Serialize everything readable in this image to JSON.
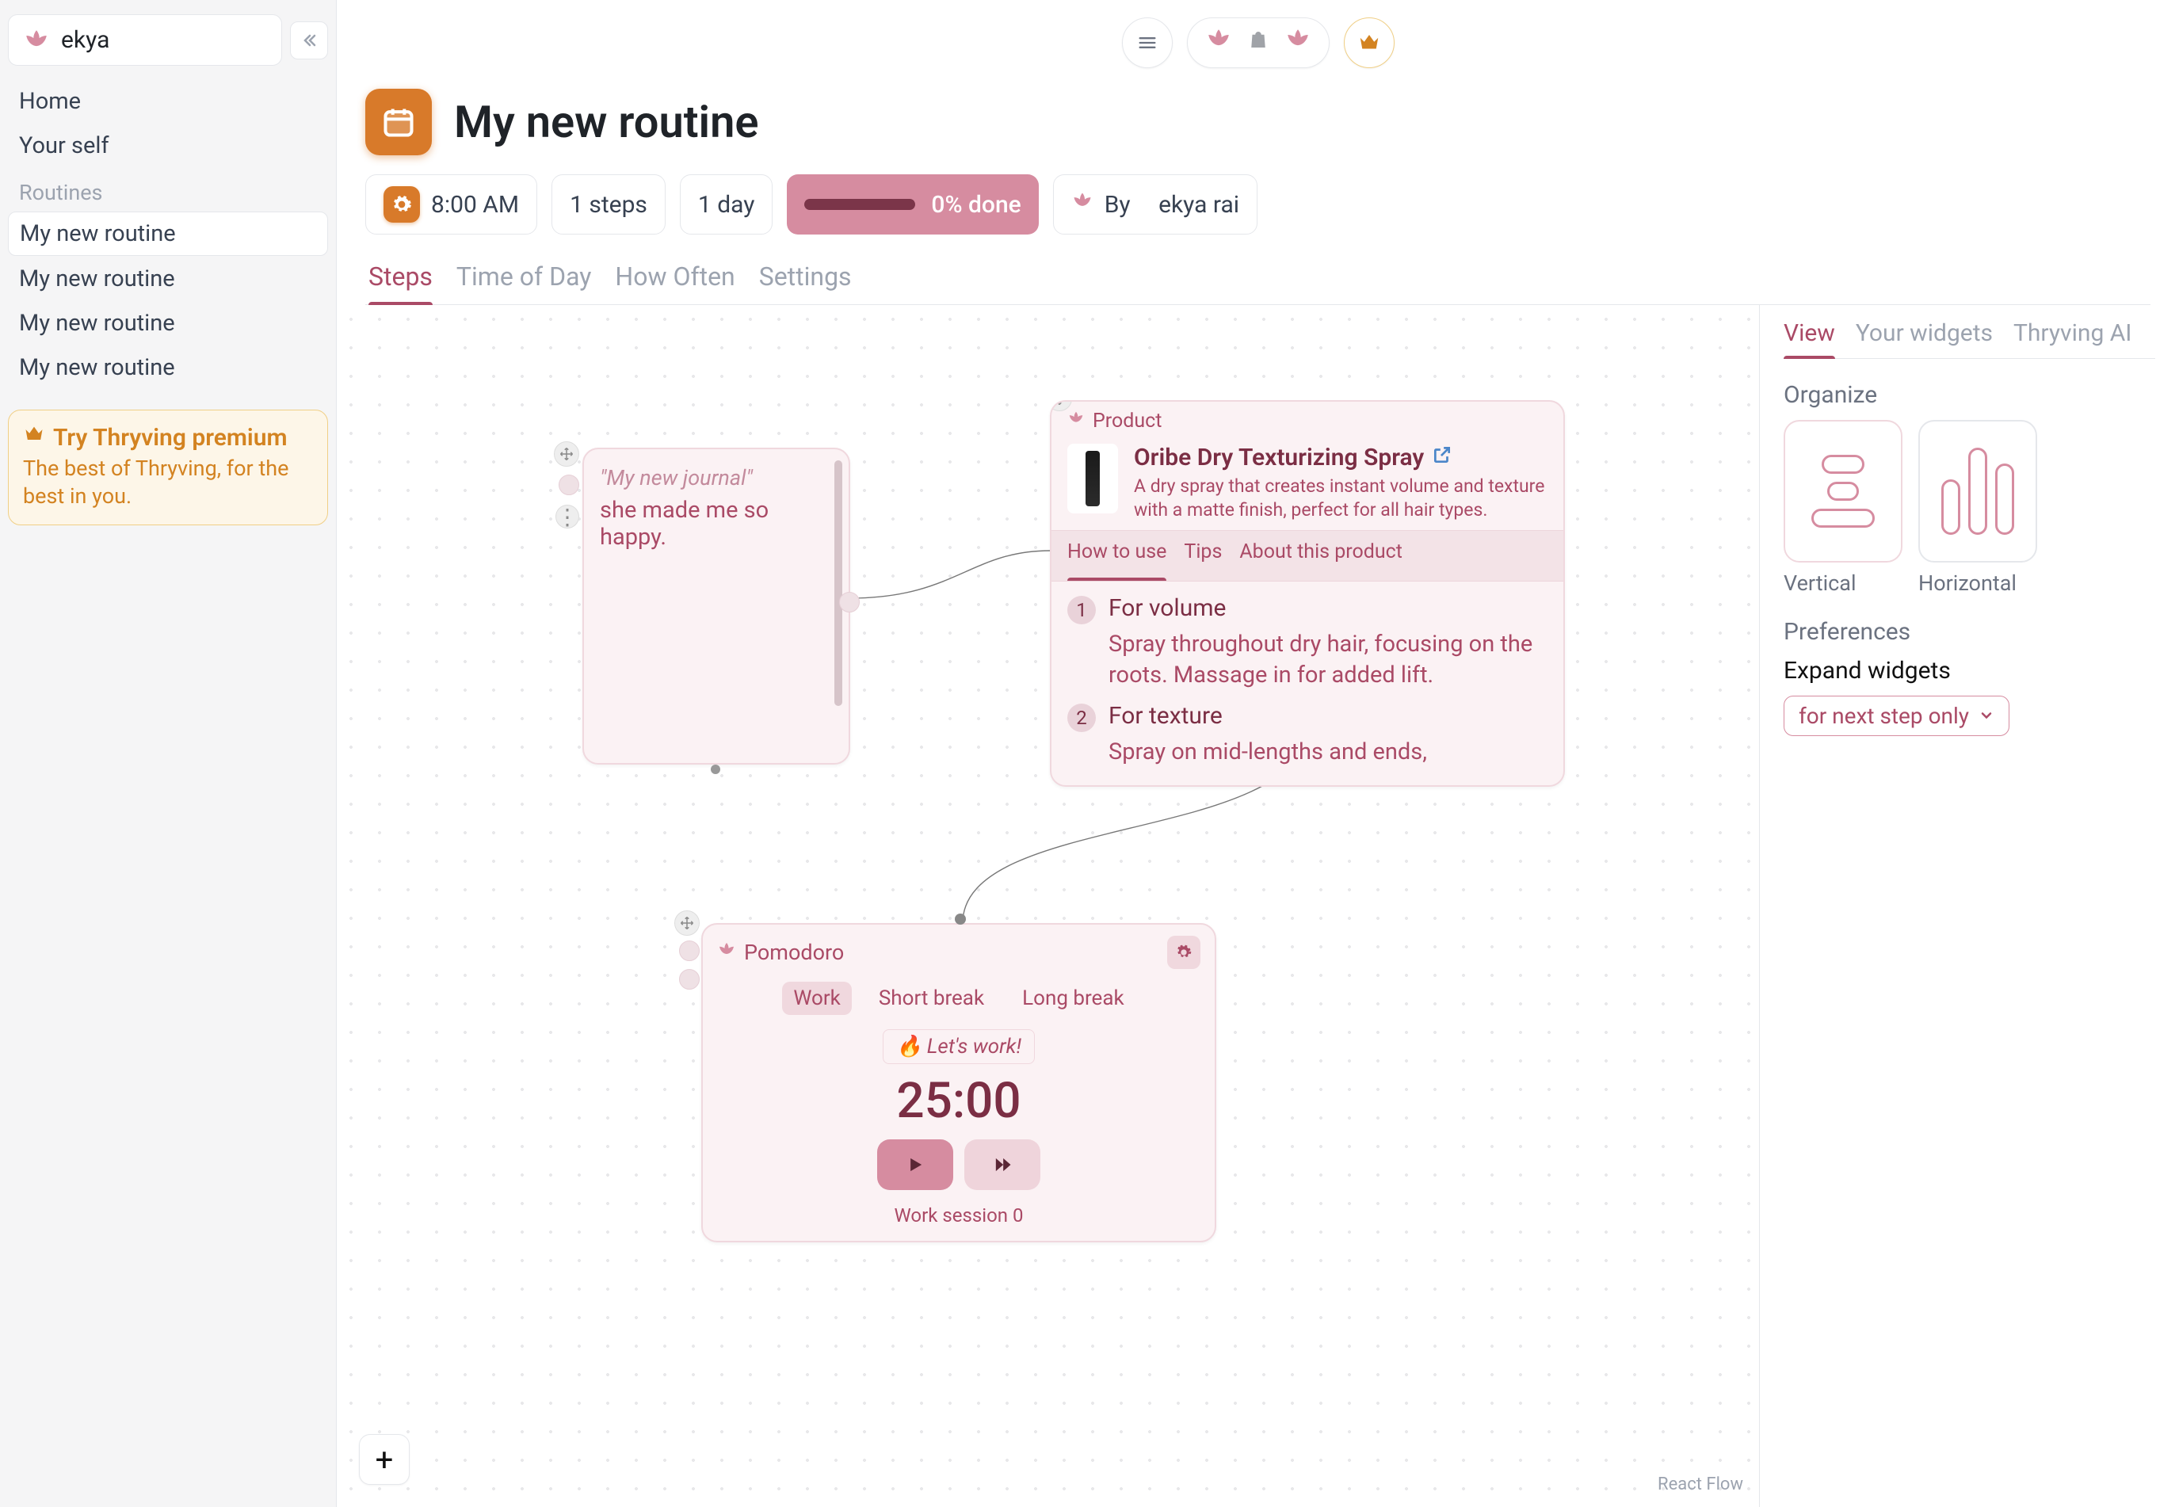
{
  "workspace": {
    "name": "ekya"
  },
  "sidebar": {
    "items": [
      {
        "label": "Home"
      },
      {
        "label": "Your self"
      }
    ],
    "routines_header": "Routines",
    "routines": [
      {
        "label": "My new routine",
        "active": true
      },
      {
        "label": "My new routine"
      },
      {
        "label": "My new routine"
      },
      {
        "label": "My new routine"
      }
    ],
    "premium": {
      "title": "Try Thryving premium",
      "subtitle": "The best of Thryving, for the best in you."
    }
  },
  "header": {
    "title": "My new routine",
    "time": "8:00 AM",
    "steps": "1 steps",
    "freq": "1 day",
    "progress_label": "0% done",
    "author_prefix": "By",
    "author": "ekya rai"
  },
  "tabs": [
    "Steps",
    "Time of Day",
    "How Often",
    "Settings"
  ],
  "canvas": {
    "journal": {
      "placeholder": "\"My new journal\"",
      "body": "she made me so happy."
    },
    "product": {
      "tag": "Product",
      "title": "Oribe Dry Texturizing Spray",
      "desc": "A dry spray that creates instant volume and texture with a matte finish, perfect for all hair types.",
      "tabs": [
        "How to use",
        "Tips",
        "About this product"
      ],
      "steps": [
        {
          "t": "For volume",
          "d": "Spray throughout dry hair, focusing on the roots. Massage in for added lift."
        },
        {
          "t": "For texture",
          "d": "Spray on mid-lengths and ends,"
        }
      ]
    },
    "pomodoro": {
      "title": "Pomodoro",
      "tabs": [
        "Work",
        "Short break",
        "Long break"
      ],
      "lets": "🔥 Let's work!",
      "time": "25:00",
      "session": "Work session 0"
    },
    "attribution": "React Flow"
  },
  "right": {
    "tabs": [
      "View",
      "Your widgets",
      "Thryving AI"
    ],
    "organize": "Organize",
    "layouts": [
      "Vertical",
      "Horizontal"
    ],
    "prefs": "Preferences",
    "expand_label": "Expand widgets",
    "expand_value": "for next step only"
  }
}
